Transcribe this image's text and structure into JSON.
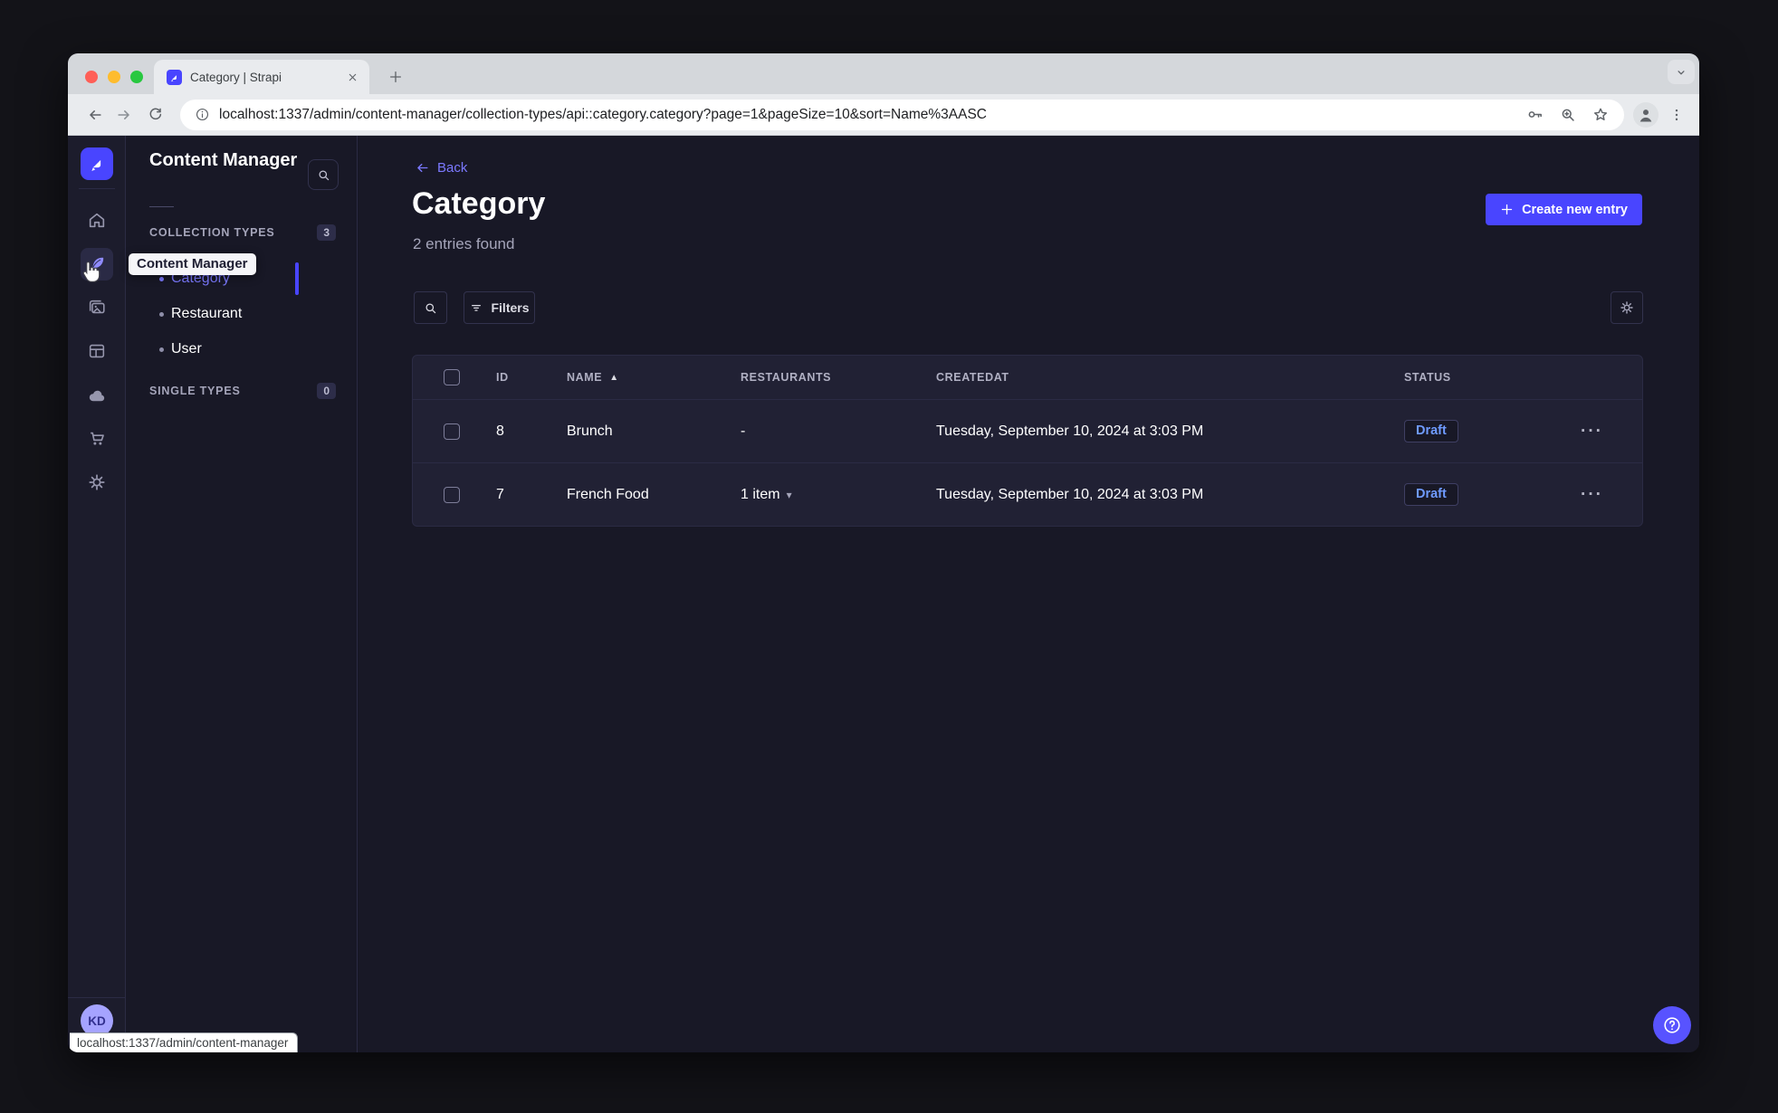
{
  "browser": {
    "tab_title": "Category | Strapi",
    "new_tab_label": "+",
    "url": "localhost:1337/admin/content-manager/collection-types/api::category.category?page=1&pageSize=10&sort=Name%3AASC",
    "status_bubble": "localhost:1337/admin/content-manager"
  },
  "rail": {
    "items": [
      "home",
      "content-manager",
      "media-library",
      "content-type-builder",
      "cloud",
      "marketplace",
      "settings"
    ],
    "active_item": "content-manager",
    "user_initials": "KD"
  },
  "subnav": {
    "title": "Content Manager",
    "search_icon": "search-icon",
    "sections": {
      "collection_types_label": "COLLECTION TYPES",
      "collection_types_count": "3",
      "single_types_label": "SINGLE TYPES",
      "single_types_count": "0"
    },
    "items": [
      {
        "label": "Category",
        "active": true
      },
      {
        "label": "Restaurant",
        "active": false
      },
      {
        "label": "User",
        "active": false
      }
    ]
  },
  "tooltip": {
    "text": "Content Manager"
  },
  "header": {
    "back_label": "Back",
    "title": "Category",
    "subtitle": "2 entries found",
    "create_button_label": "Create new entry"
  },
  "toolbar": {
    "search_icon": "search-icon",
    "filters_label": "Filters",
    "settings_icon": "gear-icon"
  },
  "table": {
    "columns": [
      "ID",
      "NAME",
      "RESTAURANTS",
      "CREATEDAT",
      "STATUS"
    ],
    "sorted_column": "NAME",
    "sort_direction": "ascending",
    "sort_glyph": "▲",
    "dropdown_glyph": "▾",
    "row_menu_glyph": "···",
    "rows": [
      {
        "id": "8",
        "name": "Brunch",
        "restaurants": "-",
        "created_at": "Tuesday, September 10, 2024 at 3:03 PM",
        "status": "Draft"
      },
      {
        "id": "7",
        "name": "French Food",
        "restaurants": "1 item",
        "created_at": "Tuesday, September 10, 2024 at 3:03 PM",
        "status": "Draft"
      }
    ]
  },
  "colors": {
    "primary": "#4945ff",
    "link": "#7b79ff",
    "draft_status": "#6f9bff",
    "app_background": "#181826",
    "card_background": "#212134"
  }
}
